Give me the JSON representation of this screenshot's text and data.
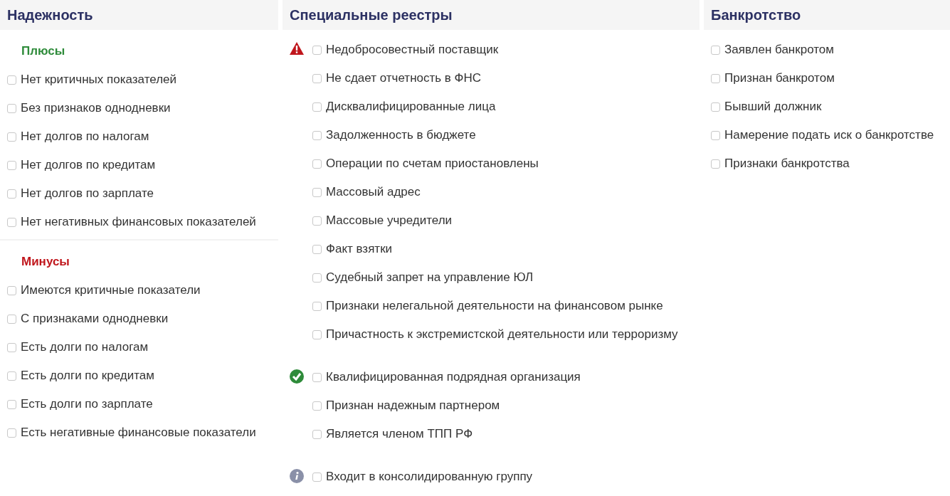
{
  "columns": [
    {
      "title": "Надежность",
      "sections": [
        {
          "title": "Плюсы",
          "kind": "plus",
          "items": [
            {
              "label": "Нет критичных показателей",
              "checked": false
            },
            {
              "label": "Без признаков однодневки",
              "checked": false
            },
            {
              "label": "Нет долгов по налогам",
              "checked": false
            },
            {
              "label": "Нет долгов по кредитам",
              "checked": false
            },
            {
              "label": "Нет долгов по зарплате",
              "checked": false
            },
            {
              "label": "Нет негативных финансовых показателей",
              "checked": false
            }
          ]
        },
        {
          "title": "Минусы",
          "kind": "minus",
          "items": [
            {
              "label": "Имеются критичные показатели",
              "checked": false
            },
            {
              "label": "С признаками однодневки",
              "checked": false
            },
            {
              "label": "Есть долги по налогам",
              "checked": false
            },
            {
              "label": "Есть долги по кредитам",
              "checked": false
            },
            {
              "label": "Есть долги по зарплате",
              "checked": false
            },
            {
              "label": "Есть негативные финансовые показатели",
              "checked": false
            }
          ]
        }
      ]
    },
    {
      "title": "Специальные реестры",
      "groups": [
        {
          "kind": "warning",
          "items": [
            {
              "label": "Недобросовестный поставщик",
              "checked": false
            },
            {
              "label": "Не сдает отчетность в ФНС",
              "checked": false
            },
            {
              "label": "Дисквалифицированные лица",
              "checked": false
            },
            {
              "label": "Задолженность в бюджете",
              "checked": false
            },
            {
              "label": "Операции по счетам приостановлены",
              "checked": false
            },
            {
              "label": "Массовый адрес",
              "checked": false
            },
            {
              "label": "Массовые учредители",
              "checked": false
            },
            {
              "label": "Факт взятки",
              "checked": false
            },
            {
              "label": "Судебный запрет на управление ЮЛ",
              "checked": false
            },
            {
              "label": "Признаки нелегальной деятельности на финансовом рынке",
              "checked": false
            },
            {
              "label": "Причастность к экстремистской деятельности или терроризму",
              "checked": false
            }
          ]
        },
        {
          "kind": "ok",
          "items": [
            {
              "label": "Квалифицированная подрядная организация",
              "checked": false
            },
            {
              "label": "Признан надежным партнером",
              "checked": false
            },
            {
              "label": "Является членом ТПП РФ",
              "checked": false
            }
          ]
        },
        {
          "kind": "info",
          "items": [
            {
              "label": "Входит в консолидированную группу",
              "checked": false
            }
          ]
        }
      ]
    },
    {
      "title": "Банкротство",
      "items": [
        {
          "label": "Заявлен банкротом",
          "checked": false
        },
        {
          "label": "Признан банкротом",
          "checked": false
        },
        {
          "label": "Бывший должник",
          "checked": false
        },
        {
          "label": "Намерение подать иск о банкротстве",
          "checked": false
        },
        {
          "label": "Признаки банкротства",
          "checked": false
        }
      ]
    }
  ]
}
